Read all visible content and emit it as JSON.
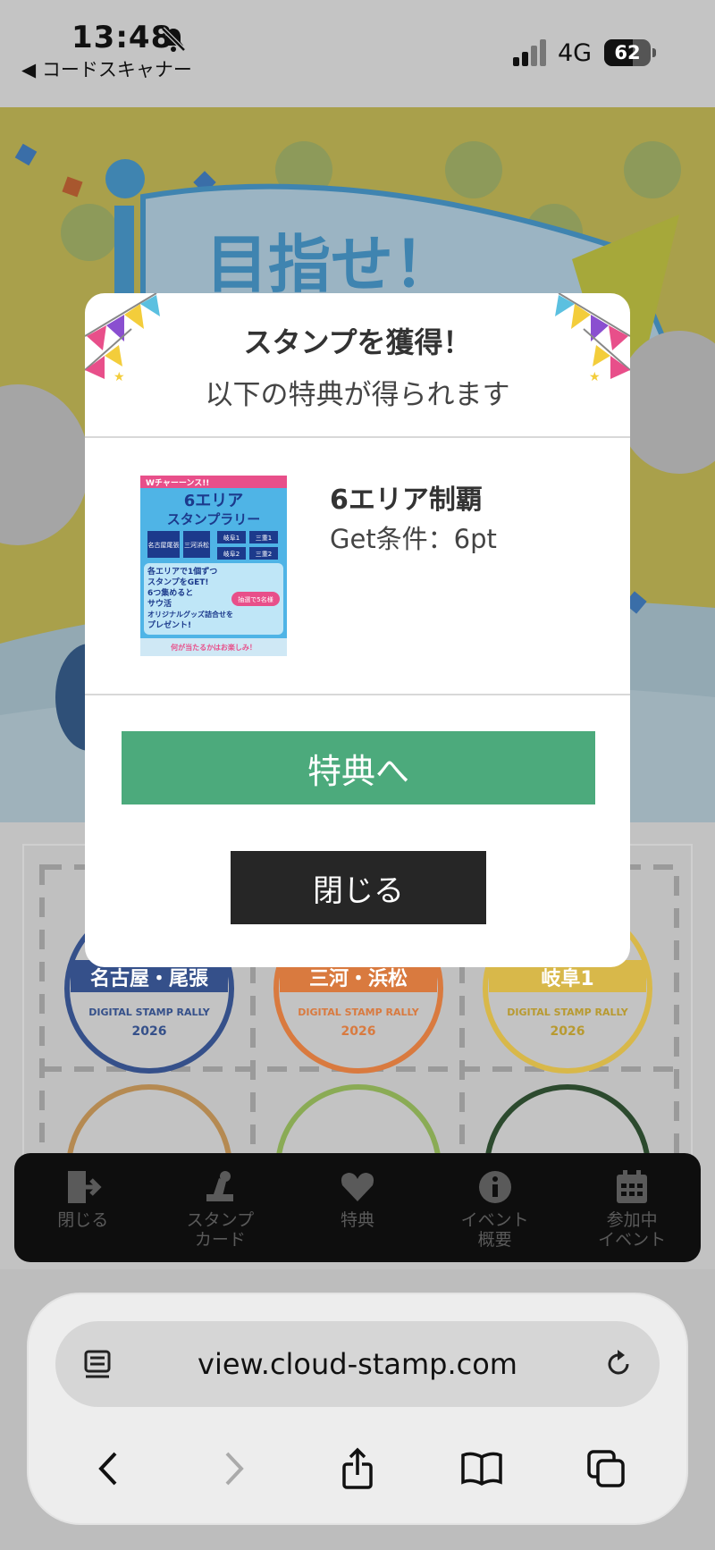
{
  "status_bar": {
    "time": "13:48",
    "back_app": "◀ コードスキャナー",
    "network": "4G",
    "battery": "62",
    "battery_level": 0.62
  },
  "page": {
    "banner_text": "目指せ！",
    "stamps": [
      {
        "name": "名古屋・尾張",
        "caption": "DIGITAL STAMP RALLY",
        "year": "2026",
        "color": "#35508a"
      },
      {
        "name": "三河・浜松",
        "caption": "DIGITAL STAMP RALLY",
        "year": "2026",
        "color": "#d97a3f"
      },
      {
        "name": "岐阜1",
        "caption": "DIGITAL STAMP RALLY",
        "year": "2026",
        "color": "#d8b84a"
      }
    ]
  },
  "modal": {
    "title": "スタンプを獲得！",
    "subtitle": "以下の特典が得られます",
    "reward_name": "6エリア制覇",
    "reward_condition": "Get条件：6pt",
    "primary_button": "特典へ",
    "close_button": "閉じる",
    "reward_image": {
      "top_banner": "Wチャーーンス!!",
      "heading1": "6エリア",
      "heading2": "スタンプラリー",
      "areas": [
        "名古屋尾張",
        "三河浜松",
        "岐阜1",
        "三重1",
        "岐阜2",
        "三重2"
      ],
      "lines": [
        "各エリアで1個ずつ",
        "スタンプをGET!",
        "6つ集めると",
        "サウ活",
        "オリジナルグッズ詰合せを",
        "プレゼント!"
      ],
      "badge": "抽選で5名様",
      "footer": "何が当たるかはお楽しみ！"
    }
  },
  "tabbar": {
    "items": [
      {
        "label1": "閉じる",
        "label2": ""
      },
      {
        "label1": "スタンプ",
        "label2": "カード"
      },
      {
        "label1": "特典",
        "label2": ""
      },
      {
        "label1": "イベント",
        "label2": "概要"
      },
      {
        "label1": "参加中",
        "label2": "イベント"
      }
    ]
  },
  "safari": {
    "url": "view.cloud-stamp.com"
  },
  "colors": {
    "primary_button": "#4caa7c",
    "close_button": "#262626",
    "overlay": "#000000"
  }
}
